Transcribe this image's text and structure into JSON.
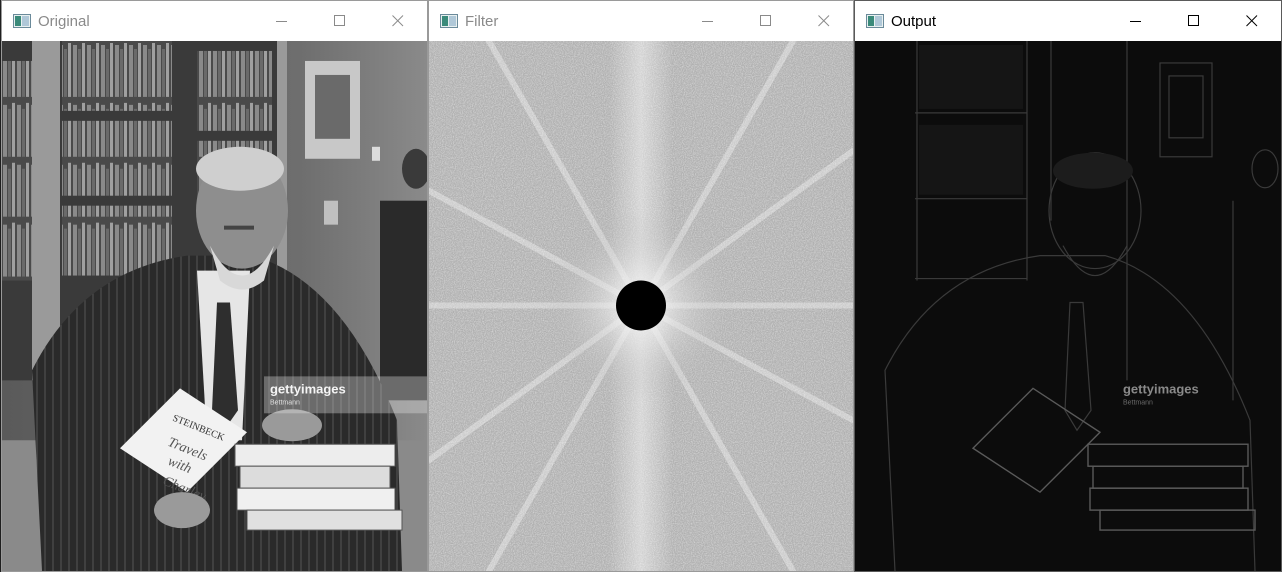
{
  "windows": {
    "original": {
      "title": "Original",
      "watermark_brand": "gettyimages",
      "watermark_credit": "Bettmann",
      "book_title": "STEINBECK",
      "book_subtitle_line1": "Travels",
      "book_subtitle_line2": "with",
      "book_subtitle_line3": "Charley"
    },
    "filter": {
      "title": "Filter"
    },
    "output": {
      "title": "Output",
      "watermark_brand": "gettyimages",
      "watermark_credit": "Bettmann"
    }
  },
  "icons": {
    "app": "opencv-window-icon",
    "minimize": "minimize-icon",
    "maximize": "maximize-icon",
    "close": "close-icon"
  },
  "colors": {
    "titlebar": "#ffffff",
    "inactive_title": "#8a8a8a",
    "active_title": "#000000",
    "filter_field": "#b4b4b4",
    "filter_mask": "#000000"
  }
}
